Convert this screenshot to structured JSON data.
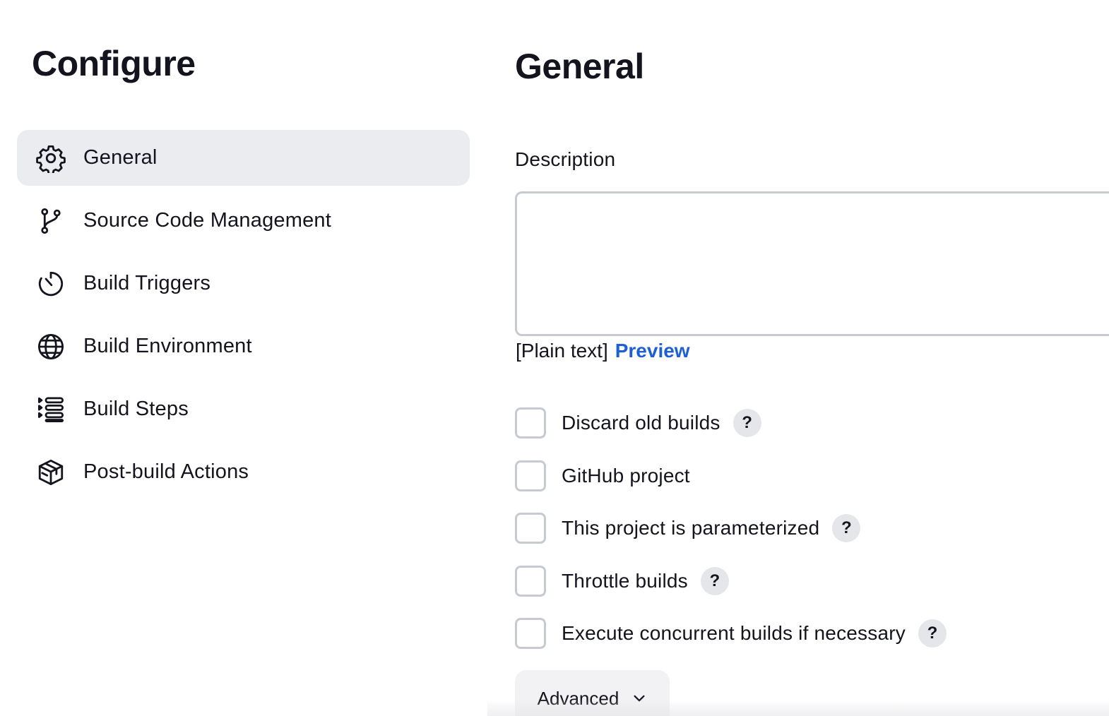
{
  "sidebar": {
    "title": "Configure",
    "items": [
      {
        "label": "General",
        "icon": "gear-icon",
        "active": true
      },
      {
        "label": "Source Code Management",
        "icon": "git-branch-icon",
        "active": false
      },
      {
        "label": "Build Triggers",
        "icon": "timer-icon",
        "active": false
      },
      {
        "label": "Build Environment",
        "icon": "globe-icon",
        "active": false
      },
      {
        "label": "Build Steps",
        "icon": "list-steps-icon",
        "active": false
      },
      {
        "label": "Post-build Actions",
        "icon": "package-icon",
        "active": false
      }
    ]
  },
  "main": {
    "title": "General",
    "description": {
      "label": "Description",
      "value": "",
      "format_label": "[Plain text]",
      "preview_label": "Preview"
    },
    "options": [
      {
        "label": "Discard old builds",
        "checked": false,
        "has_help": true
      },
      {
        "label": "GitHub project",
        "checked": false,
        "has_help": false
      },
      {
        "label": "This project is parameterized",
        "checked": false,
        "has_help": true
      },
      {
        "label": "Throttle builds",
        "checked": false,
        "has_help": true
      },
      {
        "label": "Execute concurrent builds if necessary",
        "checked": false,
        "has_help": true
      }
    ],
    "help_glyph": "?",
    "advanced_label": "Advanced"
  },
  "colors": {
    "active_nav_bg": "#ebecf0",
    "link": "#1d5fd6",
    "border": "#c6cbd1",
    "text": "#14141f"
  }
}
